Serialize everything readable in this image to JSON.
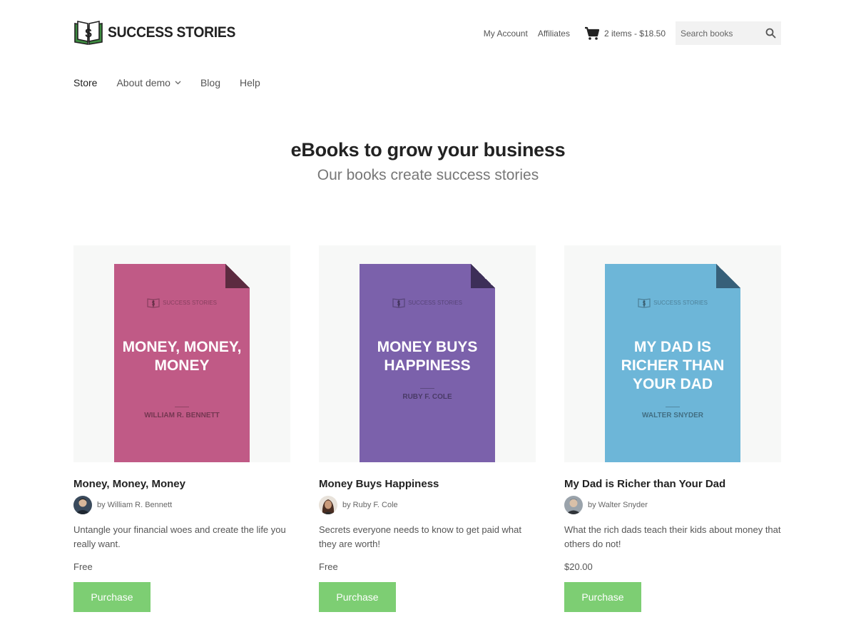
{
  "header": {
    "brand_name": "SUCCESS STORIES",
    "brand_colors": {
      "book": "#2e7d32",
      "dollar": "#222222"
    },
    "links": {
      "account": "My Account",
      "affiliates": "Affiliates"
    },
    "cart": {
      "icon": "cart-icon",
      "summary": "2 items - $18.50"
    },
    "search": {
      "placeholder": "Search books",
      "icon": "search-icon"
    }
  },
  "nav": {
    "items": [
      {
        "label": "Store",
        "active": true
      },
      {
        "label": "About demo",
        "has_dropdown": true
      },
      {
        "label": "Blog"
      },
      {
        "label": "Help"
      }
    ]
  },
  "hero": {
    "title": "eBooks to grow your business",
    "subtitle": "Our books create success stories"
  },
  "books": [
    {
      "title": "Money, Money, Money",
      "cover_brand": "SUCCESS STORIES",
      "cover_title": "MONEY, MONEY, MONEY",
      "cover_author": "WILLIAM R. BENNETT",
      "cover_color": "#c05a86",
      "cover_fold_color": "#5c2b40",
      "author": "by William R. Bennett",
      "description": "Untangle your financial woes and create the life you really want.",
      "price": "Free",
      "button": "Purchase"
    },
    {
      "title": "Money Buys Happiness",
      "cover_brand": "SUCCESS STORIES",
      "cover_title": "MONEY BUYS HAPPINESS",
      "cover_author": "RUBY F. COLE",
      "cover_color": "#7b61ab",
      "cover_fold_color": "#3d2f58",
      "author": "by Ruby F. Cole",
      "description": "Secrets everyone needs to know to get paid what they are worth!",
      "price": "Free",
      "button": "Purchase"
    },
    {
      "title": "My Dad is Richer than Your Dad",
      "cover_brand": "SUCCESS STORIES",
      "cover_title": "MY DAD IS RICHER THAN YOUR DAD",
      "cover_author": "WALTER SNYDER",
      "cover_color": "#6db6d8",
      "cover_fold_color": "#376079",
      "author": "by Walter Snyder",
      "description": "What the rich dads teach their kids about money that others do not!",
      "price": "$20.00",
      "button": "Purchase"
    }
  ],
  "colors": {
    "button": "#7dce73",
    "thumb_bg": "#f7f8f7"
  }
}
